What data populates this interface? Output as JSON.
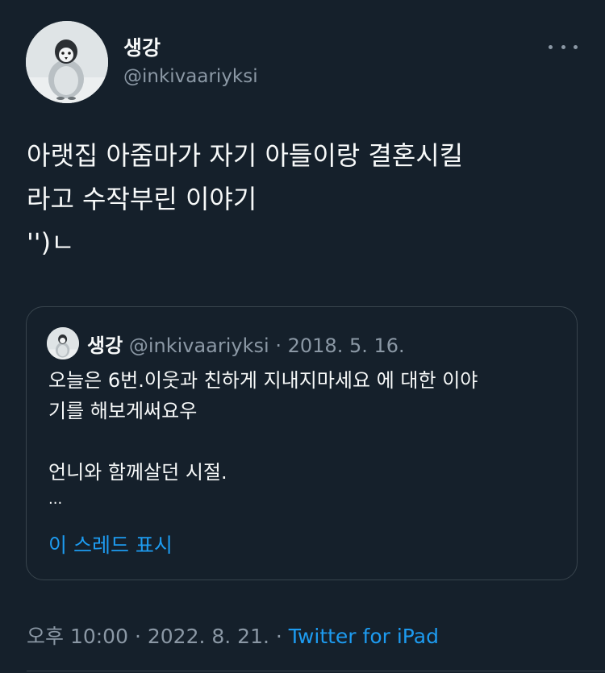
{
  "author": {
    "display_name": "생강",
    "handle": "@inkivaariyksi",
    "avatar": "penguin-chick-avatar"
  },
  "tweet": {
    "text_lines": [
      "아랫집 아줌마가 자기 아들이랑 결혼시킬",
      "라고 수작부린 이야기",
      "'')ㄴ"
    ]
  },
  "quote": {
    "display_name": "생강",
    "handle": "@inkivaariyksi",
    "separator": "·",
    "date": "2018. 5. 16.",
    "body_lines": [
      "오늘은 6번.이웃과 친하게 지내지마세요 에 대한 이야",
      "기를 해보게써요우",
      "",
      "언니와 함께살던 시절.",
      "..."
    ],
    "show_thread_label": "이 스레드 표시"
  },
  "meta": {
    "time": "오후 10:00",
    "separator": "·",
    "date": "2022. 8. 21.",
    "source": "Twitter for iPad"
  },
  "colors": {
    "background": "#15202b",
    "text_primary": "#f7f9f9",
    "text_secondary": "#8b98a5",
    "accent": "#1d9bf0",
    "border": "#38444d"
  }
}
